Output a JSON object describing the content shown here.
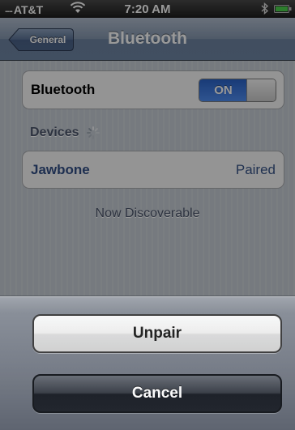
{
  "status_bar": {
    "signal_dots": ".....",
    "carrier": "AT&T",
    "time": "7:20 AM"
  },
  "nav": {
    "back_label": "General",
    "title": "Bluetooth"
  },
  "bluetooth": {
    "label": "Bluetooth",
    "toggle_state": "ON"
  },
  "devices": {
    "header": "Devices",
    "items": [
      {
        "name": "Jawbone",
        "status": "Paired"
      }
    ]
  },
  "discoverable_text": "Now Discoverable",
  "action_sheet": {
    "unpair_label": "Unpair",
    "cancel_label": "Cancel"
  },
  "icons": {
    "wifi": "wifi-icon",
    "bluetooth_status": "bluetooth-icon",
    "battery": "battery-icon",
    "spinner": "spinner-icon"
  },
  "colors": {
    "toggle_on": "#3a78e0",
    "device_name": "#324f85",
    "nav_bar": "#6d84a2"
  }
}
